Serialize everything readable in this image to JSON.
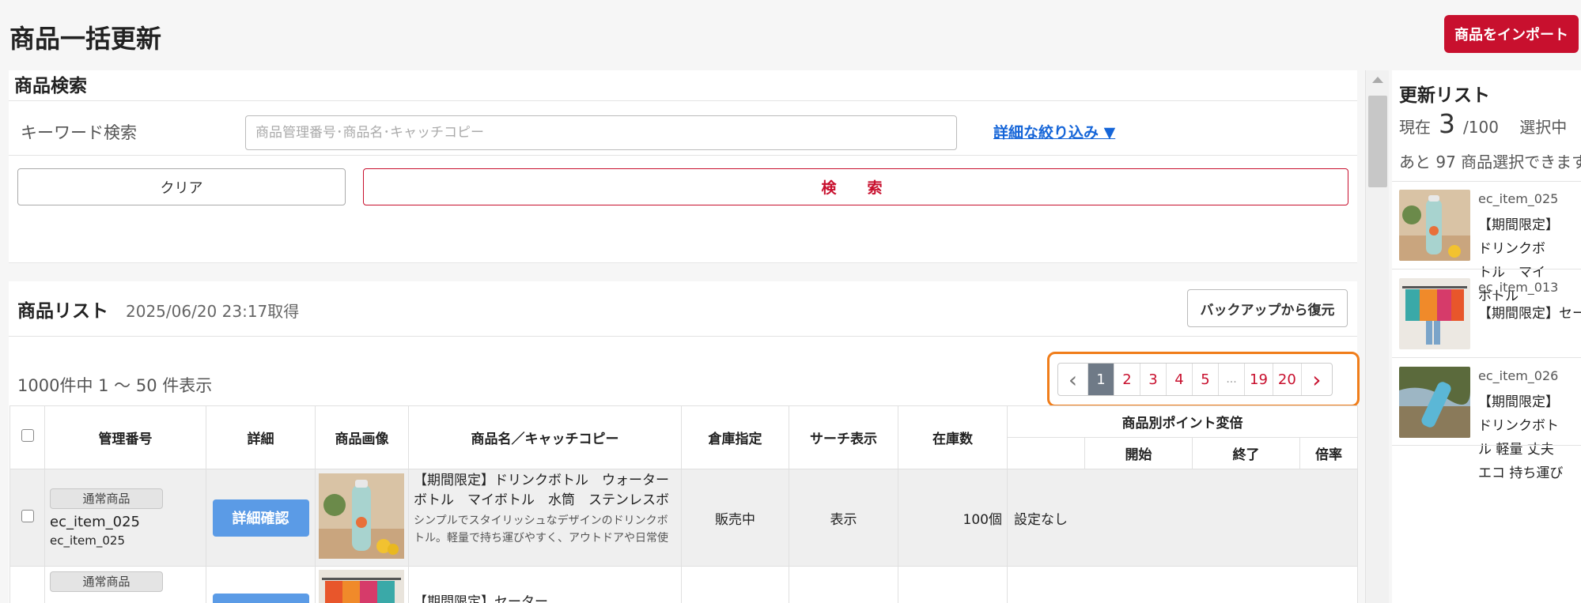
{
  "page": {
    "title": "商品一括更新",
    "import_label": "商品をインポート"
  },
  "search": {
    "title": "商品検索",
    "keyword_label": "キーワード検索",
    "keyword_placeholder": "商品管理番号･商品名･キャッチコピー",
    "keyword_value": "",
    "advanced_label": "詳細な絞り込み ▼",
    "clear_label": "クリア",
    "search_label": "検　索"
  },
  "list": {
    "title": "商品リスト",
    "fetched_at": "2025/06/20 23:17取得",
    "restore_label": "バックアップから復元",
    "count_text": "1000件中 1 〜 50 件表示",
    "pagination": {
      "prev": "‹",
      "pages": [
        "1",
        "2",
        "3",
        "4",
        "5",
        "...",
        "19",
        "20"
      ],
      "current": "1",
      "next": "›"
    },
    "columns": {
      "id": "管理番号",
      "detail": "詳細",
      "image": "商品画像",
      "name": "商品名／キャッチコピー",
      "warehouse": "倉庫指定",
      "search_display": "サーチ表示",
      "stock": "在庫数",
      "point_group": "商品別ポイント変倍",
      "point_start": "開始",
      "point_end": "終了",
      "point_rate": "倍率"
    },
    "rows": [
      {
        "type_badge": "通常商品",
        "manage_id": "ec_item_025",
        "sub_id": "ec_item_025",
        "detail_label": "詳細確認",
        "name": "【期間限定】ドリンクボトル　ウォーターボトル　マイボトル　水筒　ステンレスボトル　アウ...",
        "catch_copy": "シンプルでスタイリッシュなデザインのドリンクボトル。軽量で持ち運びやすく、アウトドアや日常使いに...",
        "warehouse": "販売中",
        "search_display": "表示",
        "stock": "100個",
        "point_setting": "設定なし"
      },
      {
        "type_badge": "通常商品",
        "name": "【期間限定】セーター"
      }
    ]
  },
  "update_list": {
    "title": "更新リスト",
    "current_label": "現在",
    "current_count": "3",
    "max_label": "/100",
    "selected_label": "選択中",
    "remaining_text": "あと 97 商品選択できます。",
    "items": [
      {
        "id": "ec_item_025",
        "name": "【期間限定】ドリンクボトル　マイボトル"
      },
      {
        "id": "ec_item_013",
        "name": "【期間限定】セーター"
      },
      {
        "id": "ec_item_026",
        "name": "【期間限定】ドリンクボトル 軽量 丈夫 エコ 持ち運び"
      }
    ]
  },
  "colors": {
    "brand_red": "#c8102e",
    "detail_blue": "#5b9be6",
    "link_blue": "#1565d8",
    "highlight_orange": "#f07d1a",
    "active_page": "#6f7a87"
  },
  "icons": {
    "prev": "chevron-left-icon",
    "next": "chevron-right-icon"
  }
}
